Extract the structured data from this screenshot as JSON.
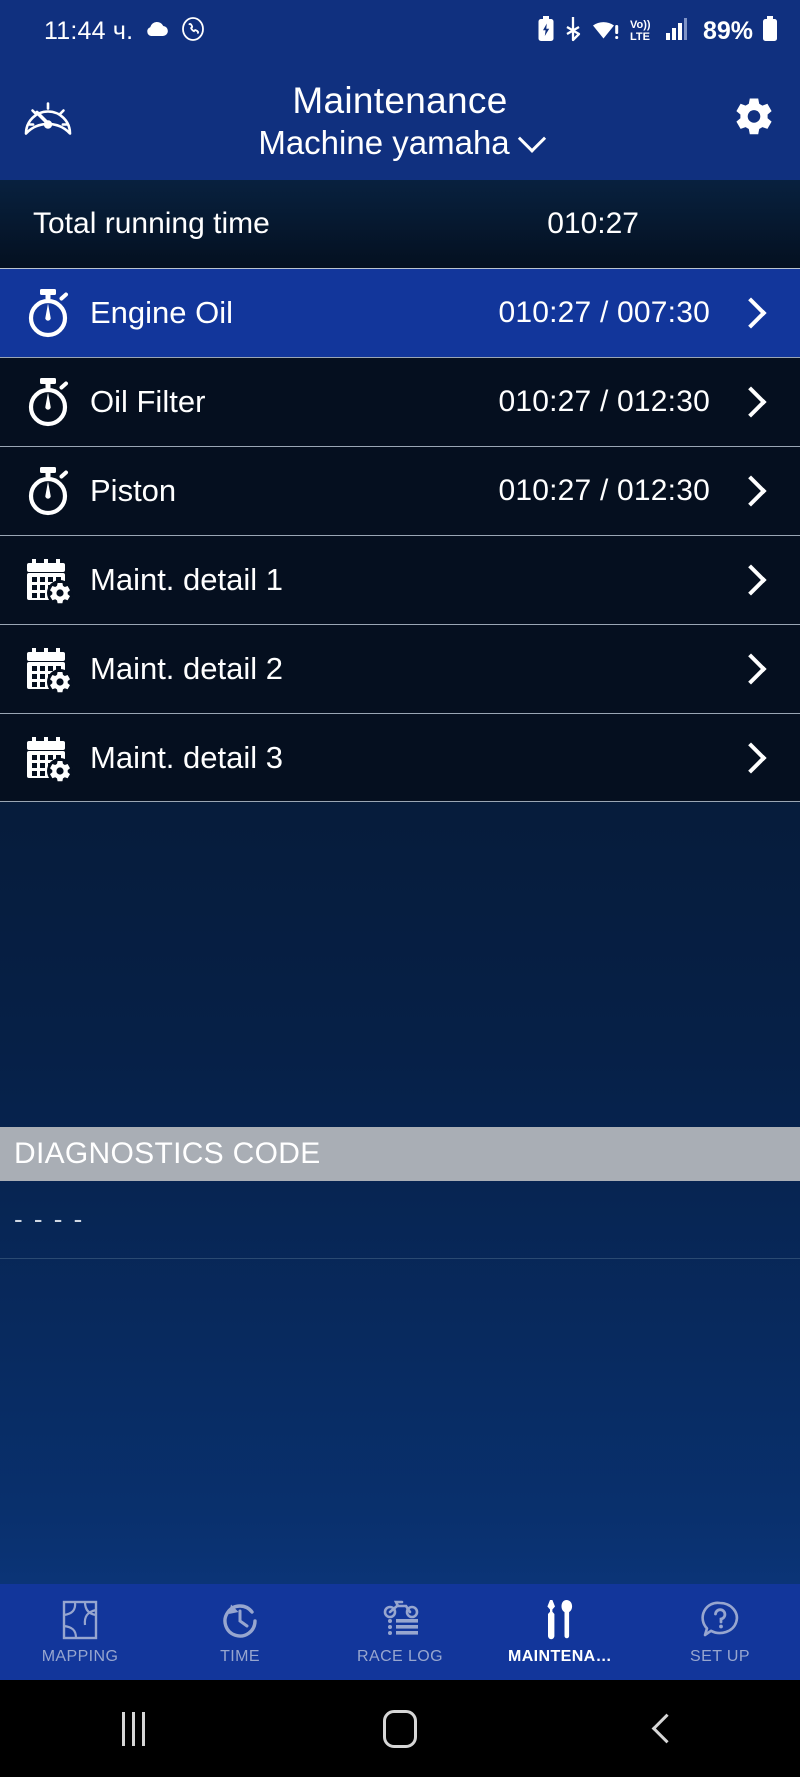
{
  "status_bar": {
    "clock": "11:44 ч.",
    "battery_percent": "89%",
    "network_label": "LTE",
    "volte_label": "Vo))",
    "icons": [
      "weather-cloud-icon",
      "call-icon",
      "battery-saver-icon",
      "bluetooth-icon",
      "wifi-warning-icon",
      "volte-icon",
      "signal-bars-icon",
      "battery-icon"
    ]
  },
  "header": {
    "title": "Maintenance",
    "subtitle": "Machine yamaha",
    "left_icon": "speedometer-icon",
    "right_icon": "gear-icon",
    "dropdown_icon": "chevron-down-icon",
    "bg_color": "#10307f"
  },
  "total": {
    "label": "Total running time",
    "value": "010:27"
  },
  "list": {
    "rows": [
      {
        "label": "Engine Oil",
        "value": "010:27 / 007:30",
        "icon": "stopwatch-icon",
        "selected": true
      },
      {
        "label": "Oil Filter",
        "value": "010:27 / 012:30",
        "icon": "stopwatch-icon",
        "selected": false
      },
      {
        "label": "Piston",
        "value": "010:27 / 012:30",
        "icon": "stopwatch-icon",
        "selected": false
      },
      {
        "label": "Maint. detail 1",
        "value": "",
        "icon": "calendar-gear-icon",
        "selected": false
      },
      {
        "label": "Maint. detail 2",
        "value": "",
        "icon": "calendar-gear-icon",
        "selected": false
      },
      {
        "label": "Maint. detail 3",
        "value": "",
        "icon": "calendar-gear-icon",
        "selected": false
      }
    ],
    "selected_bg": "#12369b",
    "row_bg": "#050f1f"
  },
  "diagnostics": {
    "header": "DIAGNOSTICS CODE",
    "code": "- - - -",
    "header_bg": "#a9aeb5"
  },
  "bottom_nav": {
    "items": [
      {
        "label": "MAPPING",
        "icon": "map-grid-icon",
        "active": false
      },
      {
        "label": "TIME",
        "icon": "clock-arrow-icon",
        "active": false
      },
      {
        "label": "RACE LOG",
        "icon": "motorcycle-list-icon",
        "active": false
      },
      {
        "label": "MAINTENA…",
        "icon": "tools-icon",
        "active": true
      },
      {
        "label": "SET UP",
        "icon": "question-bubble-icon",
        "active": false
      }
    ],
    "bg_color": "#12369b",
    "active_color": "#ffffff",
    "inactive_color": "#97a6cf"
  },
  "android_nav": {
    "buttons": [
      {
        "name": "recents",
        "icon": "recents-icon"
      },
      {
        "name": "home",
        "icon": "home-icon"
      },
      {
        "name": "back",
        "icon": "back-icon"
      }
    ]
  }
}
